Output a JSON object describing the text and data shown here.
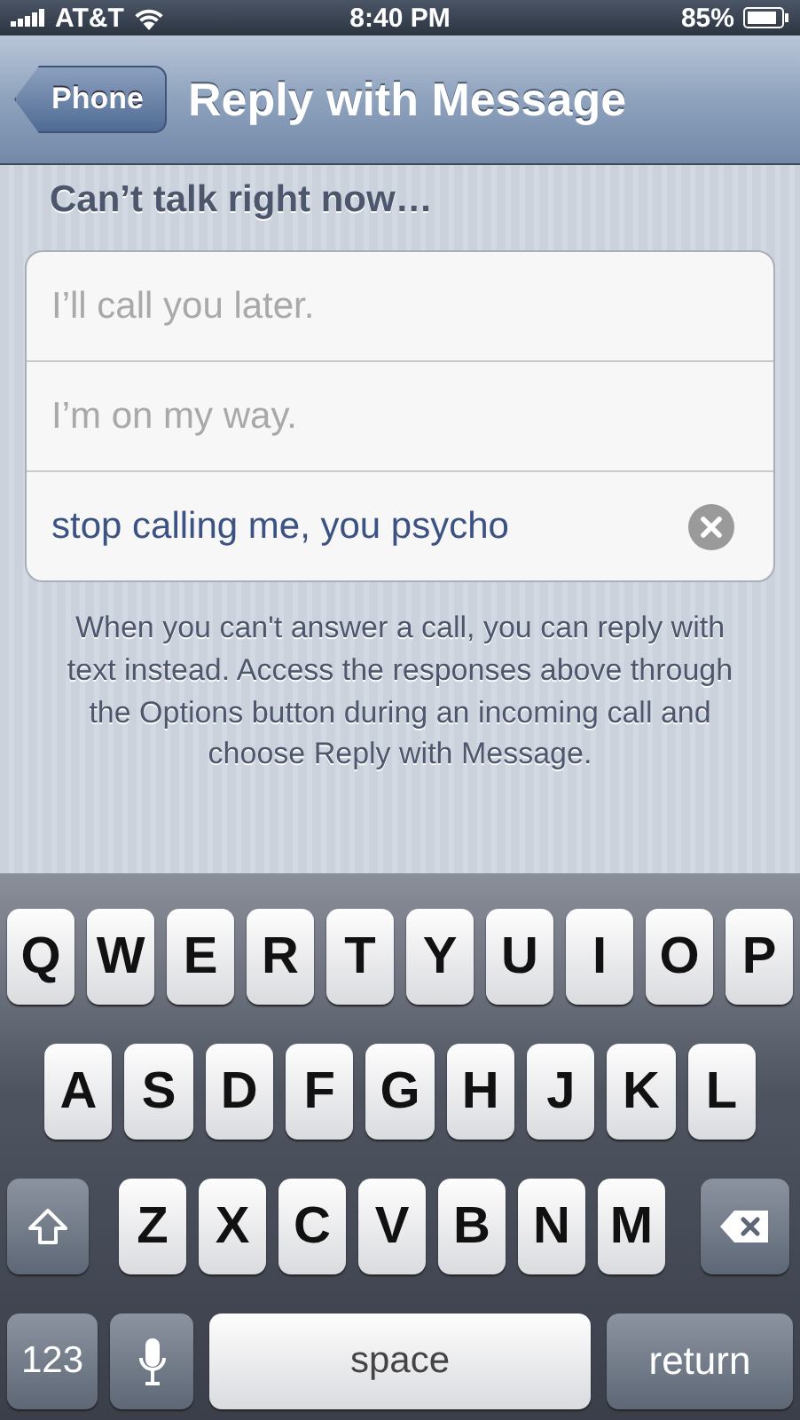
{
  "status_bar": {
    "carrier": "AT&T",
    "time": "8:40 PM",
    "battery": "85%"
  },
  "nav_bar": {
    "back": "Phone",
    "title": "Reply with Message"
  },
  "section_header": "Can’t talk right now…",
  "responses": [
    {
      "placeholder": "I’ll call you later."
    },
    {
      "placeholder": "I’m on my way."
    },
    {
      "value": "stop calling me, you psycho",
      "clear_button": true
    }
  ],
  "footer": "When you can't answer a call, you can reply with text instead. Access the responses above through the Options button during an incoming call and choose Reply with Message.",
  "keyboard": {
    "letter_rows": [
      [
        {
          "kind": "letter",
          "label": "Q"
        },
        {
          "kind": "letter",
          "label": "W"
        },
        {
          "kind": "letter",
          "label": "E"
        },
        {
          "kind": "letter",
          "label": "R"
        },
        {
          "kind": "letter",
          "label": "T"
        },
        {
          "kind": "letter",
          "label": "Y"
        },
        {
          "kind": "letter",
          "label": "U"
        },
        {
          "kind": "letter",
          "label": "I"
        },
        {
          "kind": "letter",
          "label": "O"
        },
        {
          "kind": "letter",
          "label": "P"
        }
      ],
      [
        {
          "kind": "letter",
          "label": "A"
        },
        {
          "kind": "letter",
          "label": "S"
        },
        {
          "kind": "letter",
          "label": "D"
        },
        {
          "kind": "letter",
          "label": "F"
        },
        {
          "kind": "letter",
          "label": "G"
        },
        {
          "kind": "letter",
          "label": "H"
        },
        {
          "kind": "letter",
          "label": "J"
        },
        {
          "kind": "letter",
          "label": "K"
        },
        {
          "kind": "letter",
          "label": "L"
        }
      ],
      [
        {
          "kind": "shift"
        },
        {
          "kind": "letter",
          "label": "Z"
        },
        {
          "kind": "letter",
          "label": "X"
        },
        {
          "kind": "letter",
          "label": "C"
        },
        {
          "kind": "letter",
          "label": "V"
        },
        {
          "kind": "letter",
          "label": "B"
        },
        {
          "kind": "letter",
          "label": "N"
        },
        {
          "kind": "letter",
          "label": "M"
        },
        {
          "kind": "delete"
        }
      ]
    ],
    "bottom_row": [
      {
        "kind": "mode",
        "label": "123"
      },
      {
        "kind": "dictation"
      },
      {
        "kind": "space",
        "label": "space"
      },
      {
        "kind": "return",
        "label": "return"
      }
    ]
  }
}
